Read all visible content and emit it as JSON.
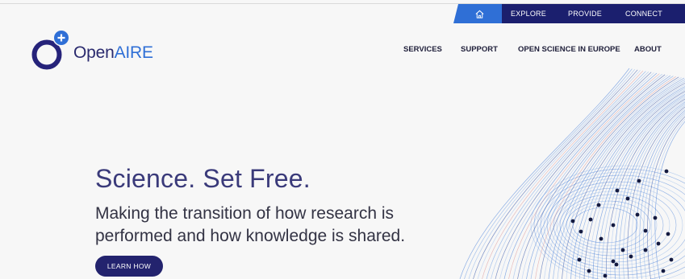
{
  "topbar": {
    "home_icon": "home-icon",
    "links": [
      "EXPLORE",
      "PROVIDE",
      "CONNECT"
    ]
  },
  "header": {
    "logo": {
      "part1": "Open",
      "part2": "AIRE",
      "icon": "openaire-logo"
    },
    "nav": [
      "SERVICES",
      "SUPPORT",
      "OPEN SCIENCE IN EUROPE",
      "ABOUT"
    ]
  },
  "hero": {
    "title": "Science. Set Free.",
    "subtitle": "Making the transition of how research is performed and how knowledge is shared.",
    "button": "LEARN HOW"
  },
  "colors": {
    "navy": "#1b1f6e",
    "blue": "#2f6fd6",
    "text": "#3a3a7a",
    "background": "#f7f7f7"
  }
}
